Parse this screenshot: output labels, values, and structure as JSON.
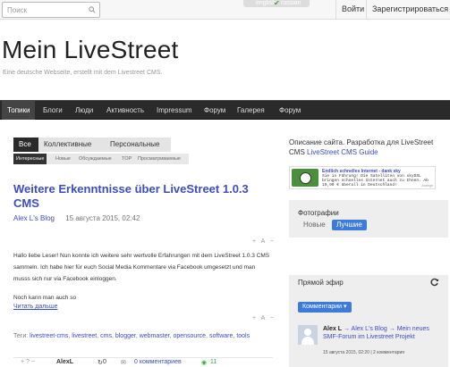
{
  "topbar": {
    "search_placeholder": "Поиск",
    "lang_current": "english",
    "lang_alt": "russian",
    "login": "Войти",
    "register": "Зарегистрироваться"
  },
  "header": {
    "title": "Mein LiveStreet",
    "description": "Eine deutsche Webseite, erstellt mit dem Livestreet CMS."
  },
  "nav": [
    "Топики",
    "Блоги",
    "Люди",
    "Активность",
    "Impressum",
    "Форум",
    "Галерея",
    "Форум"
  ],
  "tabs": [
    "Все",
    "Коллективные",
    "Персональные"
  ],
  "subtabs": [
    "Интересные",
    "Новые",
    "Обсуждаемые",
    "TOP",
    "Просматриваемые"
  ],
  "post": {
    "title": "Weitere Erkenntnisse über LiveStreet 1.0.3 CMS",
    "blog": "Alex L's Blog",
    "date": "15 августа 2015, 02:42",
    "p1": "Hallo liebe Leser! Nun konnte ich weitere sehr wertvolle Erfahrungen mit dem LiveStreet 1.0.3 CMS sammeln. Ich habe hier für euch Social Media Kommentare via Facebook umgesetzt und man musss sich nur via Facebook einloggen.",
    "p2": "Noch kann man auch so",
    "read_more": "Читать дальше",
    "tags_label": "Теги:",
    "tags": [
      "livestreet-cms",
      "livestreet",
      "cms",
      "blogger",
      "webmaster",
      "opensource",
      "software",
      "tools"
    ],
    "footer_vote": "+ ? −",
    "footer_author": "AlexL",
    "footer_favs": "0",
    "footer_comments": "0 комментариев",
    "footer_views": "11"
  },
  "sidebar": {
    "desc": "Описание сайта. Разработка для LiveStreet CMS",
    "desc_link": "LiveStreet CMS Guide",
    "ad": {
      "title": "Endlich schnelles Internet - dank sky",
      "text": "Sie in Führung! Die Satelliten von skyDSL bringen schnelles Internet auch zu Ihnen. Ab 19,90 € überall in Deutschland!",
      "source": "Anzeige"
    },
    "photos": {
      "title": "Фотографии",
      "new": "Новые",
      "best": "Лучшие"
    },
    "live": {
      "title": "Прямой эфир",
      "dropdown": "Комментарии ▾",
      "author": "Alex L",
      "arrow": "→",
      "blog": "Alex L's Blog",
      "topic": "Mein neues SMF-Forum im Livestreet Projekt",
      "meta": "15 августа 2015, 02:20 | 2 комментария"
    }
  }
}
